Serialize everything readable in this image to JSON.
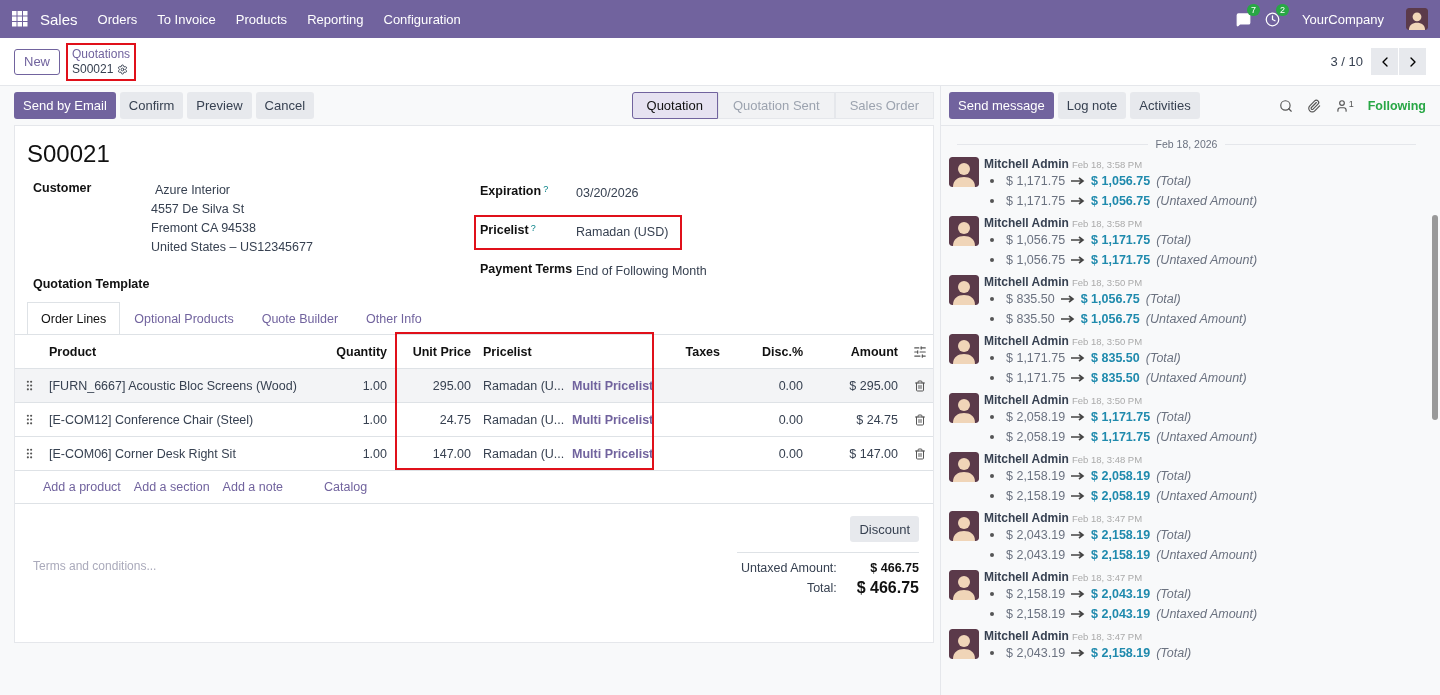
{
  "navbar": {
    "app": "Sales",
    "menu": [
      "Orders",
      "To Invoice",
      "Products",
      "Reporting",
      "Configuration"
    ],
    "badges": [
      {
        "kind": "messages",
        "count": "7"
      },
      {
        "kind": "activities",
        "count": "2"
      }
    ],
    "company": "YourCompany"
  },
  "control": {
    "new_button": "New",
    "breadcrumb": {
      "parent": "Quotations",
      "current": "S00021",
      "highlighted": true
    },
    "pager": "3 / 10"
  },
  "actions": [
    {
      "label": "Send by Email",
      "primary": true
    },
    {
      "label": "Confirm",
      "primary": false
    },
    {
      "label": "Preview",
      "primary": false
    },
    {
      "label": "Cancel",
      "primary": false
    }
  ],
  "status_steps": [
    {
      "label": "Quotation",
      "selected": true
    },
    {
      "label": "Quotation Sent",
      "selected": false
    },
    {
      "label": "Sales Order",
      "selected": false
    }
  ],
  "form": {
    "title": "S00021",
    "customer": {
      "label": "Customer",
      "name": "Azure Interior",
      "address_lines": [
        "4557 De Silva St",
        "Fremont CA 94538",
        "United States – US12345677"
      ]
    },
    "template_label": "Quotation Template",
    "fields": [
      {
        "label": "Expiration",
        "help": "?",
        "value": "03/20/2026",
        "highlighted": false
      },
      {
        "label": "Pricelist",
        "help": "?",
        "value": "Ramadan (USD)",
        "highlighted": true
      },
      {
        "label": "Payment Terms",
        "value": "End of Following Month",
        "highlighted": false
      }
    ]
  },
  "tabs": [
    {
      "label": "Order Lines",
      "selected": true
    },
    {
      "label": "Optional Products",
      "selected": false
    },
    {
      "label": "Quote Builder",
      "selected": false
    },
    {
      "label": "Other Info",
      "selected": false
    }
  ],
  "table": {
    "columns": [
      {
        "label": "Product",
        "highlighted": false
      },
      {
        "label": "Quantity",
        "highlighted": false
      },
      {
        "label": "Unit Price",
        "highlighted": true
      },
      {
        "label": "Pricelist",
        "highlighted": true
      },
      {
        "label": "Taxes",
        "highlighted": false
      },
      {
        "label": "Disc.%",
        "highlighted": false
      },
      {
        "label": "Amount",
        "highlighted": false
      }
    ],
    "rows": [
      {
        "product": "[FURN_6667] Acoustic Bloc Screens (Wood)",
        "quantity": "1.00",
        "unit_price": "295.00",
        "pricelist": "Ramadan (U...",
        "tag": "Multi Pricelist",
        "disc": "0.00",
        "amount": "$ 295.00",
        "selected": true
      },
      {
        "product": "[E-COM12] Conference Chair (Steel)",
        "quantity": "1.00",
        "unit_price": "24.75",
        "pricelist": "Ramadan (U...",
        "tag": "Multi Pricelist",
        "disc": "0.00",
        "amount": "$ 24.75",
        "selected": false
      },
      {
        "product": "[E-COM06] Corner Desk Right Sit",
        "quantity": "1.00",
        "unit_price": "147.00",
        "pricelist": "Ramadan (U...",
        "tag": "Multi Pricelist",
        "disc": "0.00",
        "amount": "$ 147.00",
        "selected": false
      }
    ],
    "add_links": [
      "Add a product",
      "Add a section",
      "Add a note",
      "Catalog"
    ]
  },
  "discount_button": "Discount",
  "terms_placeholder": "Terms and conditions...",
  "totals": [
    {
      "label": "Untaxed Amount:",
      "value": "$ 466.75",
      "kind": "untaxed"
    },
    {
      "label": "Total:",
      "value": "$ 466.75",
      "kind": "total"
    }
  ],
  "chatter": {
    "buttons": [
      {
        "label": "Send message",
        "primary": true
      },
      {
        "label": "Log note",
        "primary": false
      },
      {
        "label": "Activities",
        "primary": false
      }
    ],
    "follower_count": "1",
    "following": "Following",
    "date": "Feb 18, 2026",
    "messages": [
      {
        "author": "Mitchell Admin",
        "time": "Feb 18, 3:58 PM",
        "changes": [
          {
            "old": "$ 1,171.75",
            "new": "$ 1,056.75",
            "field": "(Total)"
          },
          {
            "old": "$ 1,171.75",
            "new": "$ 1,056.75",
            "field": "(Untaxed Amount)"
          }
        ]
      },
      {
        "author": "Mitchell Admin",
        "time": "Feb 18, 3:58 PM",
        "changes": [
          {
            "old": "$ 1,056.75",
            "new": "$ 1,171.75",
            "field": "(Total)"
          },
          {
            "old": "$ 1,056.75",
            "new": "$ 1,171.75",
            "field": "(Untaxed Amount)"
          }
        ]
      },
      {
        "author": "Mitchell Admin",
        "time": "Feb 18, 3:50 PM",
        "changes": [
          {
            "old": "$ 835.50",
            "new": "$ 1,056.75",
            "field": "(Total)"
          },
          {
            "old": "$ 835.50",
            "new": "$ 1,056.75",
            "field": "(Untaxed Amount)"
          }
        ]
      },
      {
        "author": "Mitchell Admin",
        "time": "Feb 18, 3:50 PM",
        "changes": [
          {
            "old": "$ 1,171.75",
            "new": "$ 835.50",
            "field": "(Total)"
          },
          {
            "old": "$ 1,171.75",
            "new": "$ 835.50",
            "field": "(Untaxed Amount)"
          }
        ]
      },
      {
        "author": "Mitchell Admin",
        "time": "Feb 18, 3:50 PM",
        "changes": [
          {
            "old": "$ 2,058.19",
            "new": "$ 1,171.75",
            "field": "(Total)"
          },
          {
            "old": "$ 2,058.19",
            "new": "$ 1,171.75",
            "field": "(Untaxed Amount)"
          }
        ]
      },
      {
        "author": "Mitchell Admin",
        "time": "Feb 18, 3:48 PM",
        "changes": [
          {
            "old": "$ 2,158.19",
            "new": "$ 2,058.19",
            "field": "(Total)"
          },
          {
            "old": "$ 2,158.19",
            "new": "$ 2,058.19",
            "field": "(Untaxed Amount)"
          }
        ]
      },
      {
        "author": "Mitchell Admin",
        "time": "Feb 18, 3:47 PM",
        "changes": [
          {
            "old": "$ 2,043.19",
            "new": "$ 2,158.19",
            "field": "(Total)"
          },
          {
            "old": "$ 2,043.19",
            "new": "$ 2,158.19",
            "field": "(Untaxed Amount)"
          }
        ]
      },
      {
        "author": "Mitchell Admin",
        "time": "Feb 18, 3:47 PM",
        "changes": [
          {
            "old": "$ 2,158.19",
            "new": "$ 2,043.19",
            "field": "(Total)"
          },
          {
            "old": "$ 2,158.19",
            "new": "$ 2,043.19",
            "field": "(Untaxed Amount)"
          }
        ]
      },
      {
        "author": "Mitchell Admin",
        "time": "Feb 18, 3:47 PM",
        "changes": [
          {
            "old": "$ 2,043.19",
            "new": "$ 2,158.19",
            "field": "(Total)"
          }
        ]
      }
    ]
  }
}
